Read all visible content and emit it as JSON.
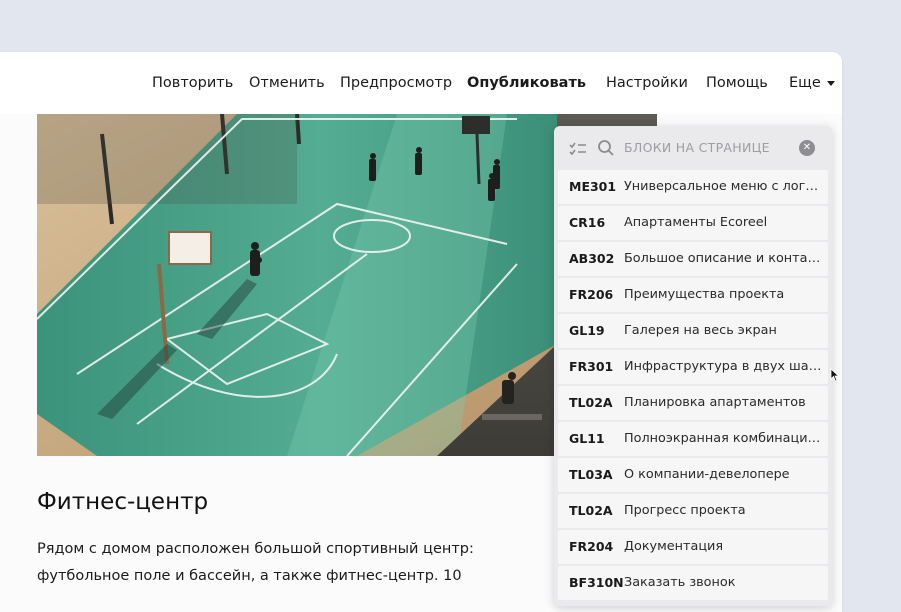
{
  "nav": {
    "items": [
      {
        "label": "Повторить"
      },
      {
        "label": "Отменить"
      },
      {
        "label": "Предпросмотр"
      },
      {
        "label": "Опубликовать"
      },
      {
        "label": "Настройки"
      },
      {
        "label": "Помощь"
      },
      {
        "label": "Еще"
      }
    ]
  },
  "section": {
    "title": "Фитнес-центр",
    "text": "Рядом с домом расположен большой спортивный центр: футбольное поле и бассейн, а также фитнес-центр. 10"
  },
  "panel": {
    "search_placeholder": "БЛОКИ НА СТРАНИЦЕ",
    "icons": {
      "toggle": "list-check-icon",
      "search": "search-icon",
      "clear": "close-icon"
    },
    "blocks": [
      {
        "code": "ME301",
        "name": "Универсальное меню с логот..."
      },
      {
        "code": "CR16",
        "name": "Апартаменты Ecoreel"
      },
      {
        "code": "AB302",
        "name": "Большое описание и контакты"
      },
      {
        "code": "FR206",
        "name": "Преимущества проекта"
      },
      {
        "code": "GL19",
        "name": "Галерея на весь экран"
      },
      {
        "code": "FR301",
        "name": "Инфраструктура в двух шагах"
      },
      {
        "code": "TL02A",
        "name": "Планировка апартаментов"
      },
      {
        "code": "GL11",
        "name": "Полноэкранная комбинация..."
      },
      {
        "code": "TL03A",
        "name": "О компании-девелопере"
      },
      {
        "code": "TL02A",
        "name": "Прогресс проекта"
      },
      {
        "code": "FR204",
        "name": "Документация"
      },
      {
        "code": "BF310N",
        "name": "Заказать звонок"
      }
    ]
  },
  "colors": {
    "court": "#3f9e84",
    "sand": "#c9a97c",
    "panel_bg": "#eaeaec"
  }
}
